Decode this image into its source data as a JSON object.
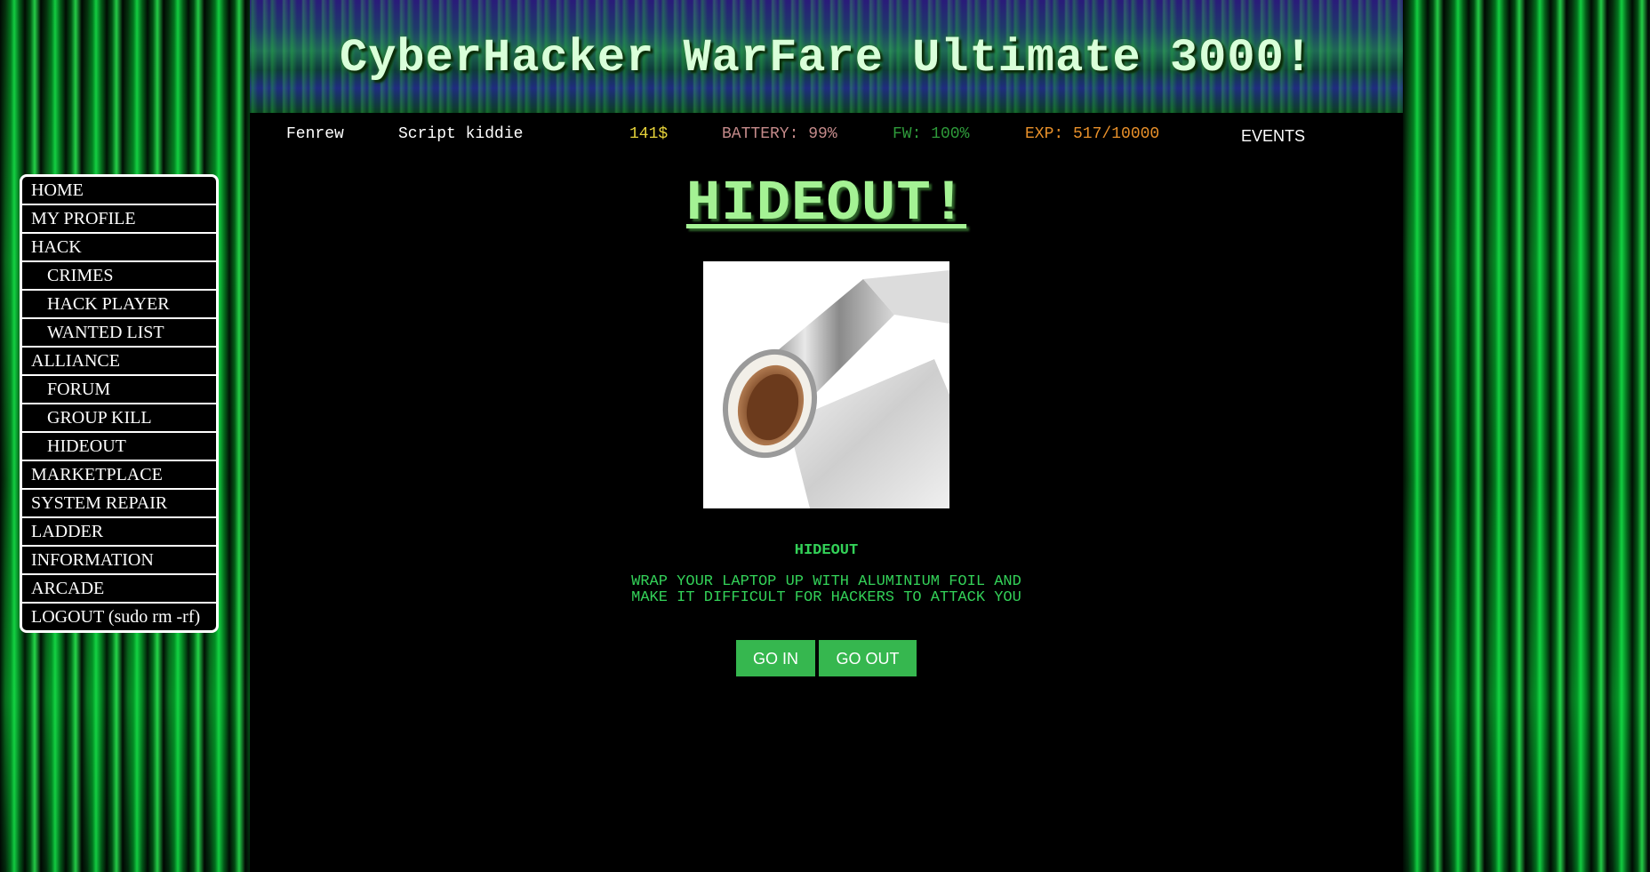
{
  "header": {
    "title": "CyberHacker WarFare Ultimate 3000!"
  },
  "status": {
    "username": "Fenrew",
    "rank": "Script kiddie",
    "money": "141$",
    "battery": "BATTERY: 99%",
    "firewall": "FW: 100%",
    "experience": "EXP: 517/10000",
    "events": "EVENTS"
  },
  "colors": {
    "money": "#e6d23a",
    "battery": "#c48a8a",
    "firewall": "#2e9a3a",
    "experience": "#e8902a",
    "accent_green": "#36b74f",
    "heading_green": "#a4f294"
  },
  "sidebar": {
    "items": [
      {
        "label": "HOME",
        "sub": false
      },
      {
        "label": "MY PROFILE",
        "sub": false
      },
      {
        "label": "HACK",
        "sub": false
      },
      {
        "label": "CRIMES",
        "sub": true
      },
      {
        "label": "HACK PLAYER",
        "sub": true
      },
      {
        "label": "WANTED LIST",
        "sub": true
      },
      {
        "label": "ALLIANCE",
        "sub": false
      },
      {
        "label": "FORUM",
        "sub": true
      },
      {
        "label": "GROUP KILL",
        "sub": true
      },
      {
        "label": "HIDEOUT",
        "sub": true
      },
      {
        "label": "MARKETPLACE",
        "sub": false
      },
      {
        "label": "SYSTEM REPAIR",
        "sub": false
      },
      {
        "label": "LADDER",
        "sub": false
      },
      {
        "label": "INFORMATION",
        "sub": false
      },
      {
        "label": "ARCADE",
        "sub": false
      },
      {
        "label": "LOGOUT (sudo rm -rf)",
        "sub": false
      }
    ]
  },
  "main": {
    "heading": "HIDEOUT!",
    "image_icon": "aluminium-foil-roll",
    "item_name": "HIDEOUT",
    "item_description": "WRAP YOUR LAPTOP UP WITH ALUMINIUM FOIL AND MAKE IT DIFFICULT FOR HACKERS TO ATTACK YOU",
    "go_in_label": "GO IN",
    "go_out_label": "GO OUT"
  }
}
